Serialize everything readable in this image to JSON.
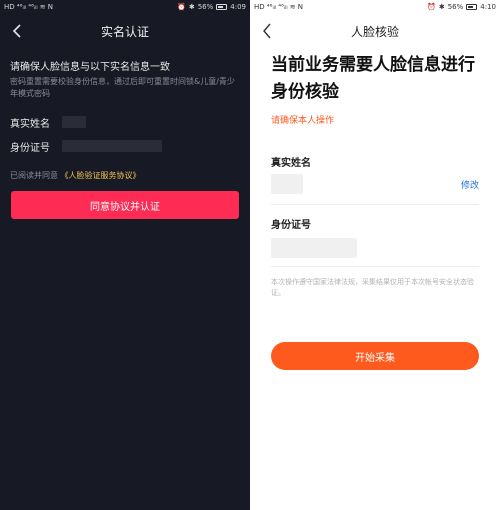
{
  "left": {
    "status": {
      "carrier": "HD ⁴⁶ᵢₗₗ ⁴⁶ᵢₗₗ ≋ N",
      "battery": "56%",
      "time": "4:09"
    },
    "nav_title": "实名认证",
    "heading": "请确保人脸信息与以下实名信息一致",
    "description": "密码重置需要校验身份信息，通过后即可重置时间锁&儿童/青少年模式密码",
    "name_label": "真实姓名",
    "id_label": "身份证号",
    "agree_prefix": "已阅读并同意",
    "agree_link": "《人脸验证服务协议》",
    "button": "同意协议并认证"
  },
  "right": {
    "status": {
      "carrier": "HD ⁴⁶ᵢₗₗ ⁴⁶ᵢₗₗ ≋ N",
      "battery": "56%",
      "time": "4:10"
    },
    "nav_title": "人脸核验",
    "title": "当前业务需要人脸信息进行身份核验",
    "subtitle": "请确保本人操作",
    "name_label": "真实姓名",
    "edit": "修改",
    "id_label": "身份证号",
    "note": "本次操作遵守国家法律法规，采集结果仅用于本次帐号安全状态验证。",
    "button": "开始采集"
  },
  "colors": {
    "dark_bg": "#171924",
    "primary_red": "#fe2c55",
    "link_yellow": "#f5c451",
    "orange": "#ff5a1e",
    "edit_blue": "#1e6fd9"
  }
}
